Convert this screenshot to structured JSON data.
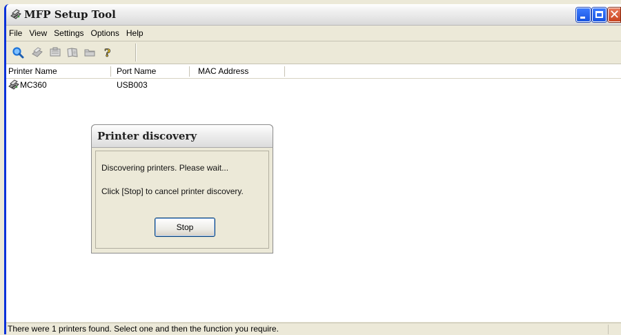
{
  "window": {
    "title": "MFP Setup Tool",
    "icon": "printer-icon",
    "controls": [
      "minimize-icon",
      "maximize-icon",
      "close-icon"
    ]
  },
  "menu": {
    "items": [
      "File",
      "View",
      "Settings",
      "Options",
      "Help"
    ]
  },
  "toolbar": {
    "icons": [
      "search-printer-icon",
      "printer-settings-icon",
      "network-icon",
      "book-icon",
      "folder-icon",
      "help-icon"
    ]
  },
  "list": {
    "columns": [
      "Printer Name",
      "Port Name",
      "MAC Address"
    ],
    "rows": [
      {
        "icon": "printer-icon",
        "printer_name": "MC360",
        "port_name": "USB003",
        "mac_address": ""
      }
    ]
  },
  "status": {
    "text": "There were 1 printers found. Select one and then the function you require."
  },
  "dialog": {
    "title": "Printer discovery",
    "line1": "Discovering printers. Please wait...",
    "line2": "Click [Stop] to cancel printer discovery.",
    "stop_label": "Stop"
  },
  "colors": {
    "window_border": "#0831d9",
    "background": "#ece9d8",
    "close_button": "#c9441f",
    "search_icon": "#1e74d9"
  }
}
